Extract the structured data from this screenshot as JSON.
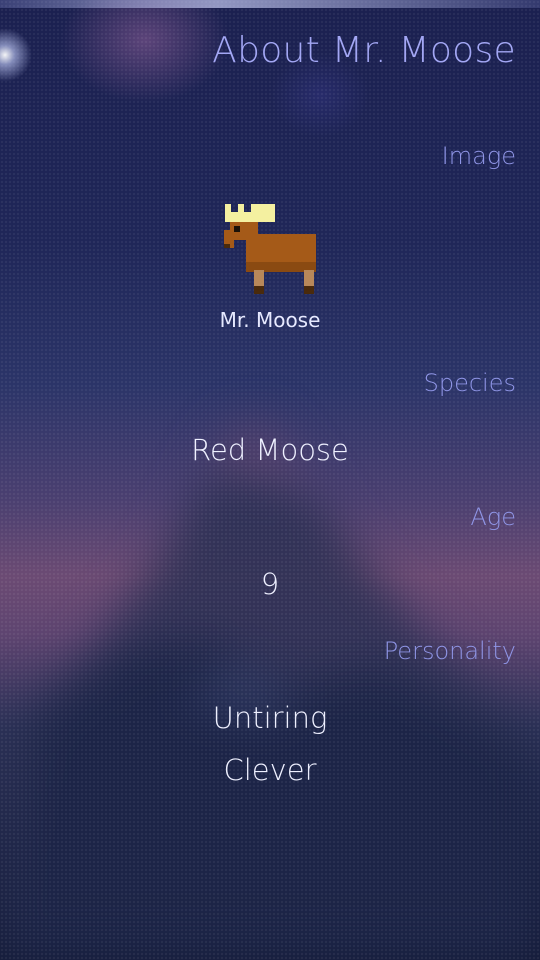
{
  "page": {
    "title": "About Mr. Moose"
  },
  "image_section": {
    "label": "Image",
    "caption": "Mr. Moose",
    "icon": "moose-icon"
  },
  "species_section": {
    "label": "Species",
    "value": "Red Moose"
  },
  "age_section": {
    "label": "Age",
    "value": "9"
  },
  "personality_section": {
    "label": "Personality",
    "traits": [
      "Untiring",
      "Clever"
    ]
  },
  "colors": {
    "label": "#8f95e6",
    "header": "#a3a7f4",
    "value": "#eef0ff",
    "moose_body": "#a55a18",
    "moose_crown": "#f4f0a0"
  }
}
